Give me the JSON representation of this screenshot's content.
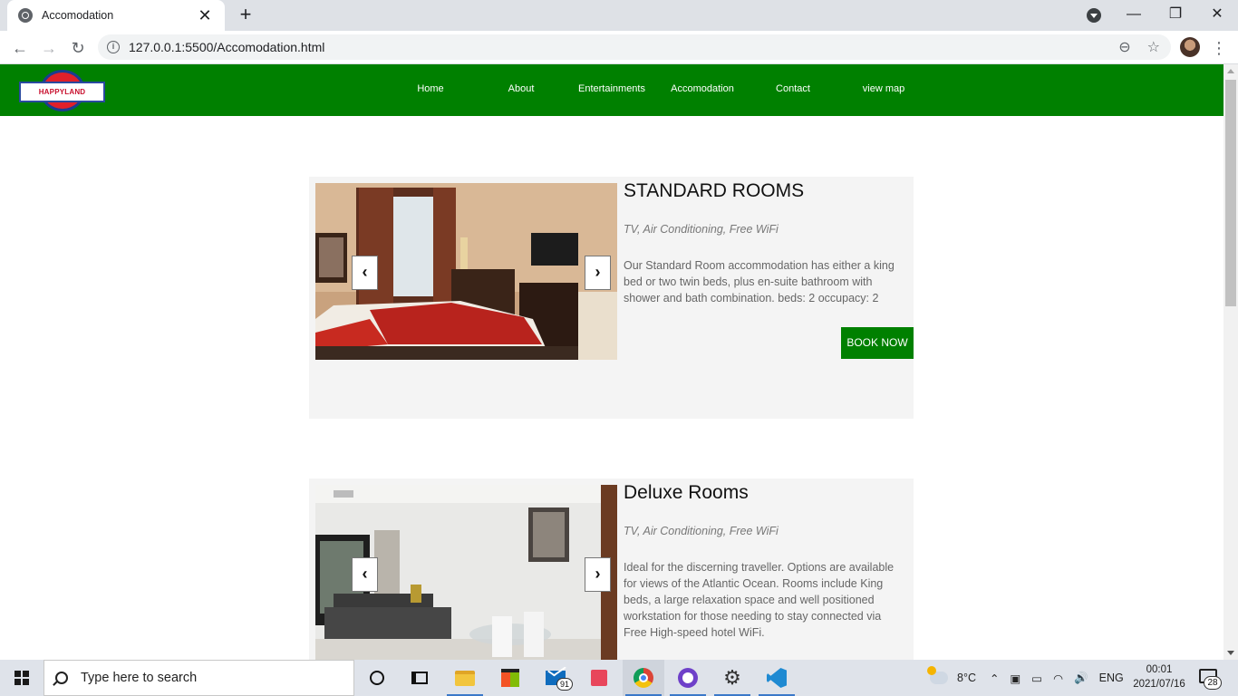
{
  "browser": {
    "tab_title": "Accomodation",
    "tab_close": "✕",
    "new_tab": "+",
    "url": "127.0.0.1:5500/Accomodation.html",
    "window_controls": {
      "minimize": "—",
      "restore": "❐",
      "close": "✕"
    }
  },
  "site": {
    "logo_text": "HAPPYLAND",
    "nav": [
      {
        "label": "Home"
      },
      {
        "label": "About"
      },
      {
        "label": "Entertainments"
      },
      {
        "label": "Accomodation"
      },
      {
        "label": "Contact"
      },
      {
        "label": "view map"
      }
    ]
  },
  "rooms": [
    {
      "title": "STANDARD ROOMS",
      "amenities": "TV, Air Conditioning, Free WiFi",
      "description": "Our Standard Room accommodation has either a king bed or two twin beds, plus en-suite bathroom with shower and bath combination. beds: 2 occupacy: 2",
      "book_label": "BOOK NOW",
      "prev": "‹",
      "next": "›"
    },
    {
      "title": "Deluxe Rooms",
      "amenities": "TV, Air Conditioning, Free WiFi",
      "description": "Ideal for the discerning traveller. Options are available for views of the Atlantic Ocean. Rooms include King beds, a large relaxation space and well positioned workstation for those needing to stay connected via Free High-speed hotel WiFi.",
      "prev": "‹",
      "next": "›"
    }
  ],
  "taskbar": {
    "search_placeholder": "Type here to search",
    "mail_badge": "91",
    "temperature": "8°C",
    "language": "ENG",
    "time": "00:01",
    "date": "2021/07/16",
    "notification_count": "28"
  },
  "colors": {
    "nav_green": "#008000",
    "card_bg": "#f4f4f4",
    "button_green": "#008000"
  }
}
